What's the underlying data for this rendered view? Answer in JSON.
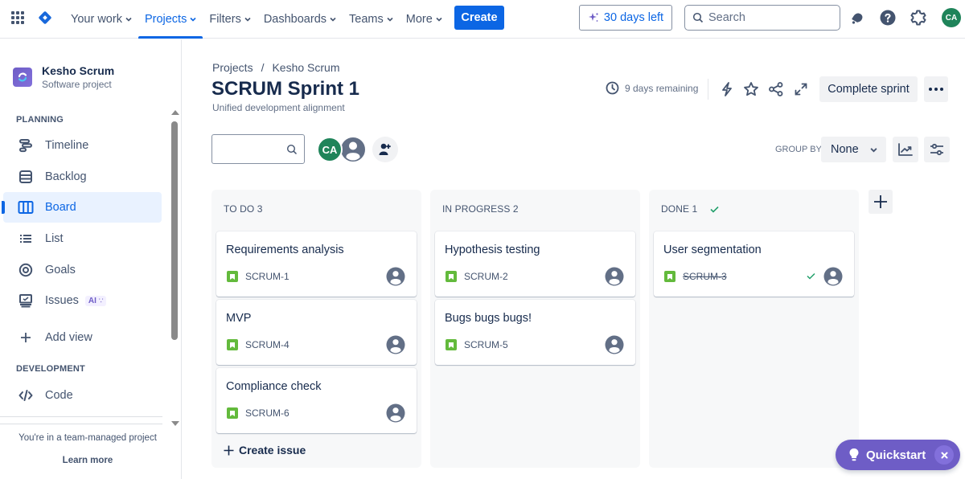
{
  "topnav": {
    "items": [
      {
        "label": "Your work",
        "active": false
      },
      {
        "label": "Projects",
        "active": true
      },
      {
        "label": "Filters",
        "active": false
      },
      {
        "label": "Dashboards",
        "active": false
      },
      {
        "label": "Teams",
        "active": false
      },
      {
        "label": "More",
        "active": false
      }
    ],
    "create_label": "Create",
    "trial_label": "30 days left",
    "search_placeholder": "Search",
    "user_initials": "CA",
    "accent_color": "#0c66e4"
  },
  "sidebar": {
    "project_name": "Kesho Scrum",
    "project_type": "Software project",
    "planning_title": "PLANNING",
    "planning_items": [
      {
        "label": "Timeline",
        "icon": "timeline-icon"
      },
      {
        "label": "Backlog",
        "icon": "backlog-icon"
      },
      {
        "label": "Board",
        "icon": "board-icon",
        "active": true
      },
      {
        "label": "List",
        "icon": "list-icon"
      },
      {
        "label": "Goals",
        "icon": "goals-icon"
      },
      {
        "label": "Issues",
        "icon": "issues-icon",
        "badge": "AI"
      }
    ],
    "add_view_label": "Add view",
    "development_title": "DEVELOPMENT",
    "development_items": [
      {
        "label": "Code",
        "icon": "code-icon"
      }
    ],
    "footer_text": "You're in a team-managed project",
    "learn_more_label": "Learn more"
  },
  "header": {
    "breadcrumb": [
      "Projects",
      "Kesho Scrum"
    ],
    "breadcrumb_sep": "/",
    "title": "SCRUM Sprint 1",
    "subtitle": "Unified development alignment",
    "remaining": "9 days remaining",
    "complete_label": "Complete sprint"
  },
  "toolbar": {
    "search_value": "",
    "avatar_initials": "CA",
    "group_by_label": "GROUP BY",
    "group_by_value": "None"
  },
  "board": {
    "columns": [
      {
        "title": "TO DO 3",
        "cards": [
          {
            "title": "Requirements analysis",
            "key": "SCRUM-1"
          },
          {
            "title": "MVP",
            "key": "SCRUM-4"
          },
          {
            "title": "Compliance check",
            "key": "SCRUM-6"
          }
        ],
        "create_label": "Create issue"
      },
      {
        "title": "IN PROGRESS 2",
        "cards": [
          {
            "title": "Hypothesis testing",
            "key": "SCRUM-2"
          },
          {
            "title": "Bugs bugs bugs!",
            "key": "SCRUM-5"
          }
        ]
      },
      {
        "title": "DONE 1",
        "done": true,
        "cards": [
          {
            "title": "User segmentation",
            "key": "SCRUM-3",
            "done": true
          }
        ]
      }
    ]
  },
  "quickstart": {
    "label": "Quickstart"
  }
}
